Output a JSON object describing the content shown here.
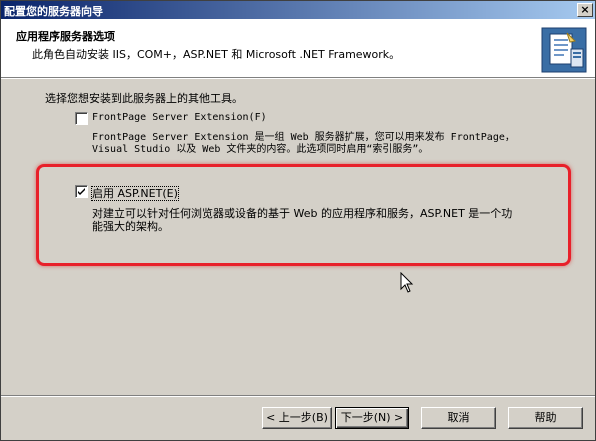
{
  "window": {
    "title": "配置您的服务器向导",
    "close_glyph": "×"
  },
  "header": {
    "title": "应用程序服务器选项",
    "subtitle": "此角色自动安装 IIS，COM+，ASP.NET 和 Microsoft .NET Framework。"
  },
  "intro": "选择您想安装到此服务器上的其他工具。",
  "options": [
    {
      "label": "FrontPage Server Extension",
      "accel": "(F)",
      "checked": false,
      "desc_line1": "FrontPage Server Extension 是一组 Web 服务器扩展，您可以用来发布 FrontPage，",
      "desc_line2": "Visual Studio 以及 Web 文件夹的内容。此选项同时启用“索引服务”。"
    },
    {
      "label": "启用 ASP.NET",
      "accel": "(E)",
      "checked": true,
      "desc_line1": "对建立可以针对任何浏览器或设备的基于 Web 的应用程序和服务，ASP.NET 是一个功",
      "desc_line2": "能强大的架构。"
    }
  ],
  "buttons": {
    "back": "< 上一步(B)",
    "next": "下一步(N) >",
    "cancel": "取消",
    "help": "帮助"
  },
  "colors": {
    "highlight": "#e8202a",
    "titlebar_start": "#0a246a",
    "titlebar_end": "#a6caf0"
  }
}
